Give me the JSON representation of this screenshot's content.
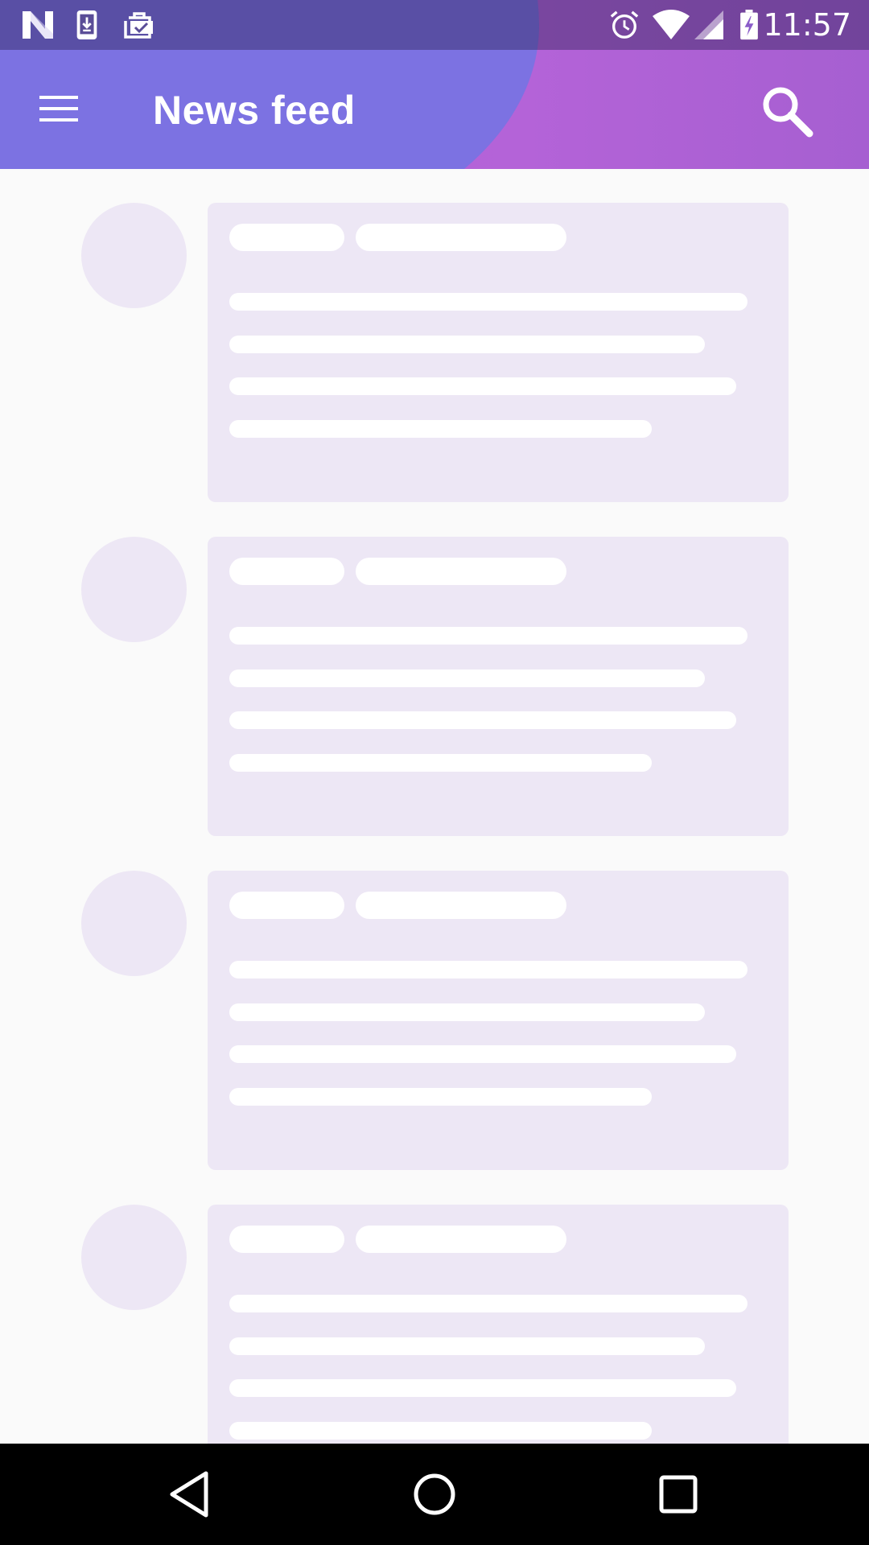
{
  "status_bar": {
    "time": "11:57",
    "left_icons": [
      "n-logo-icon",
      "download-icon",
      "briefcase-check-icon"
    ],
    "right_icons": [
      "alarm-icon",
      "wifi-icon",
      "signal-icon",
      "battery-charging-icon"
    ]
  },
  "toolbar": {
    "title": "News feed",
    "menu_icon": "hamburger-menu-icon",
    "search_icon": "search-icon"
  },
  "feed": {
    "state": "loading-placeholder",
    "visible_items": 4
  },
  "nav_bar": {
    "buttons": [
      "back-icon",
      "home-icon",
      "recents-icon"
    ]
  },
  "colors": {
    "toolbar_primary": "#7c72e2",
    "toolbar_accent": "#b65ed9",
    "placeholder": "#ede7f5",
    "placeholder_line": "#ffffff",
    "background": "#fafafa",
    "nav_bar": "#000000"
  }
}
